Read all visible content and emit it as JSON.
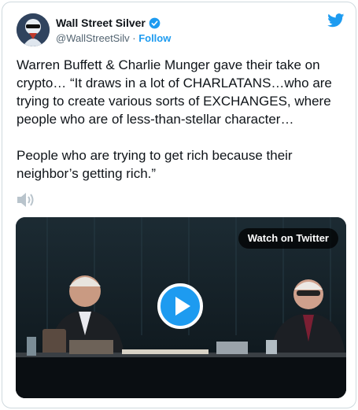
{
  "tweet": {
    "author": {
      "display_name": "Wall Street Silver",
      "handle": "@WallStreetSilv",
      "separator": " · ",
      "follow_label": "Follow",
      "verified": true
    },
    "text": "Warren Buffett & Charlie Munger gave their take on crypto… “It draws in a lot of CHARLATANS…who are trying to create various sorts of EXCHANGES, where people who are of less-than-stellar character…\n\nPeople who are trying to get rich because their neighbor’s getting rich.”",
    "media": {
      "type": "video",
      "watch_label": "Watch on Twitter"
    }
  },
  "icons": {
    "brand": "twitter-bird-icon",
    "verified": "verified-badge-icon",
    "audio": "speaker-icon",
    "play": "play-icon"
  },
  "colors": {
    "accent": "#1d9bf0",
    "text": "#0f1419",
    "secondary_text": "#536471",
    "border": "#cfd9de"
  }
}
